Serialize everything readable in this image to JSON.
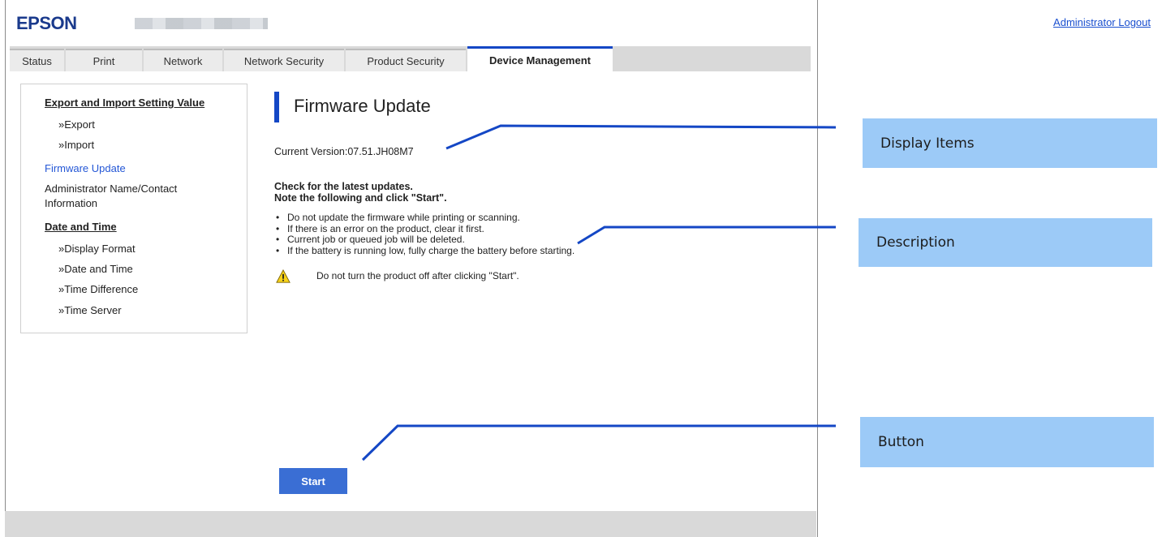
{
  "header": {
    "logo": "EPSON",
    "logout_link": "Administrator Logout"
  },
  "tabs": [
    {
      "label": "Status"
    },
    {
      "label": "Print"
    },
    {
      "label": "Network"
    },
    {
      "label": "Network Security"
    },
    {
      "label": "Product Security"
    },
    {
      "label": "Device Management",
      "active": true
    }
  ],
  "sidebar": {
    "items": [
      {
        "label": "Export and Import Setting Value"
      },
      {
        "label": "»Export"
      },
      {
        "label": "»Import"
      },
      {
        "label": "Firmware Update"
      },
      {
        "label": "Administrator Name/Contact"
      },
      {
        "label": "Information"
      },
      {
        "label": "Date and Time"
      },
      {
        "label": "»Display Format"
      },
      {
        "label": "»Date and Time"
      },
      {
        "label": "»Time Difference"
      },
      {
        "label": "»Time Server"
      }
    ]
  },
  "main": {
    "title": "Firmware Update",
    "current_version": "Current Version:07.51.JH08M7",
    "check_line1": "Check for the latest updates.",
    "check_line2": "Note the following and click \"Start\".",
    "notes": [
      "Do not update the firmware while printing or scanning.",
      "If there is an error on the product, clear it first.",
      "Current job or queued job will be deleted.",
      "If the battery is running low, fully charge the battery before starting."
    ],
    "warning": "Do not turn the product off after clicking \"Start\".",
    "start_button": "Start"
  },
  "callouts": {
    "display_items": "Display Items",
    "description": "Description",
    "button": "Button"
  },
  "colors": {
    "brand": "#1a3a8c",
    "tab_active": "#1447c5",
    "link": "#2457d6",
    "button": "#3a6ed4",
    "callout_bg": "#9ccaf7"
  }
}
